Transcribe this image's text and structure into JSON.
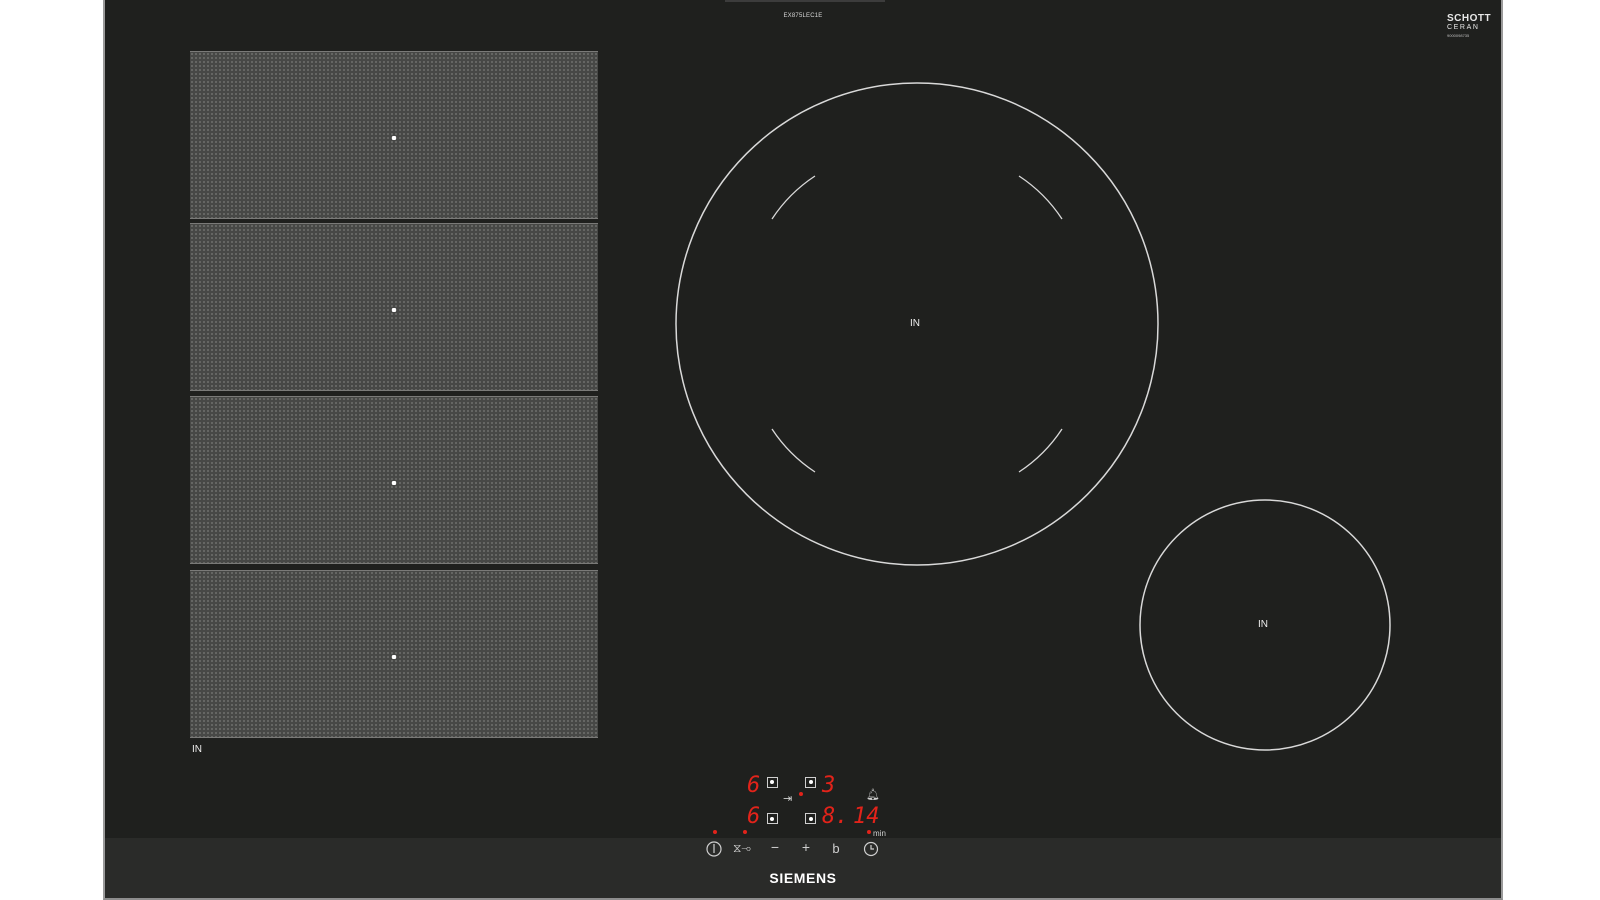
{
  "hob": {
    "model_code": "EX875LEC1E",
    "brand": "SIEMENS",
    "glass_logo": {
      "line1": "SCHOTT",
      "line2": "CERAN",
      "line3": "9000098735"
    },
    "colors": {
      "glass": "#1f201e",
      "zone_mesh": "#474846",
      "display_red": "#e2231a",
      "frame": "#9a9a9a"
    }
  },
  "cooking_zones": {
    "flex_zone_label": "IN",
    "large_zone_label": "IN",
    "small_zone_label": "IN"
  },
  "display": {
    "power_front_left": "6",
    "power_rear_left": "6",
    "power_rear_right": "3",
    "power_front_right": "8.",
    "timer_minutes": "14",
    "timer_unit": "min"
  },
  "controls": {
    "power_icon": "power-icon",
    "child_lock_icon": "child-lock-icon",
    "minus_label": "−",
    "plus_label": "+",
    "boost_label": "b",
    "timer_icon": "clock-icon",
    "bell_icon": "bell-icon",
    "flex_link_icon": "flex-link-icon"
  }
}
